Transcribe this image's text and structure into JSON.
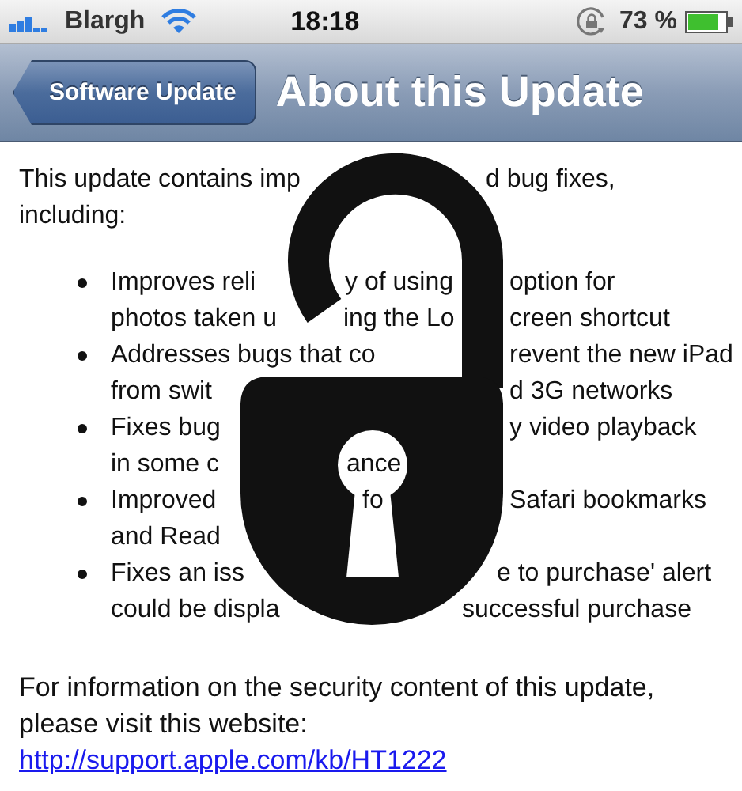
{
  "status_bar": {
    "carrier": "Blargh",
    "time": "18:18",
    "battery": "73 %"
  },
  "nav_bar": {
    "back": "Software Update",
    "title": "About this Update"
  },
  "intro": [
    [
      "This update contains imp",
      "d bug fixes,"
    ],
    [
      "including:"
    ]
  ],
  "bullets": [
    [
      [
        "Improves reli",
        "y of using",
        "option for"
      ],
      [
        "photos taken u",
        "ing the Lo",
        "creen shortcut"
      ]
    ],
    [
      [
        "Addresses bugs that co",
        "revent the new iPad"
      ],
      [
        "from swit",
        "d 3G networks"
      ]
    ],
    [
      [
        "Fixes bug",
        "y video playback"
      ],
      [
        "in some c",
        "ance"
      ]
    ],
    [
      [
        "Improved",
        "fo",
        "Safari bookmarks"
      ],
      [
        "and Read"
      ]
    ],
    [
      [
        "Fixes an iss",
        "e to purchase' alert"
      ],
      [
        "could be displa",
        "successful purchase"
      ]
    ]
  ],
  "footer": {
    "text": "For information on the security content of this update, please visit this website:",
    "link": "http://support.apple.com/kb/HT1222"
  }
}
